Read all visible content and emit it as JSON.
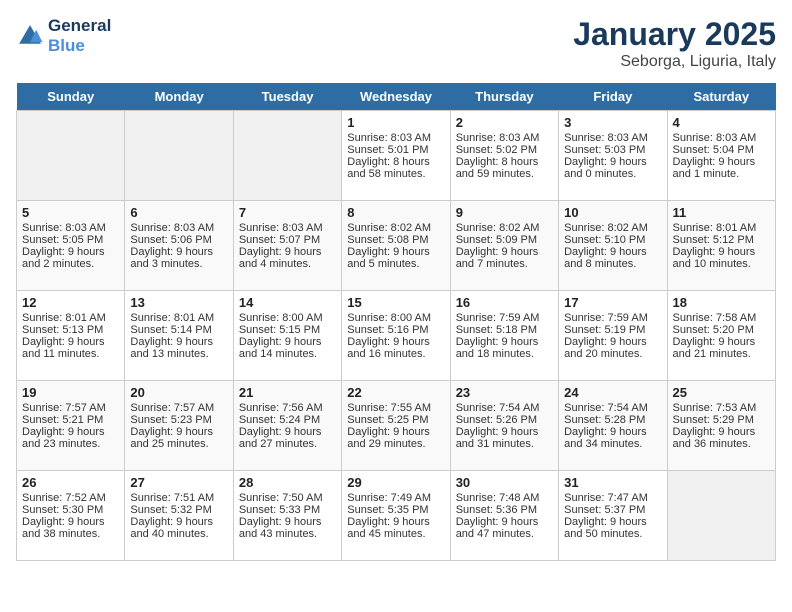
{
  "header": {
    "logo_line1": "General",
    "logo_line2": "Blue",
    "title": "January 2025",
    "subtitle": "Seborga, Liguria, Italy"
  },
  "days_of_week": [
    "Sunday",
    "Monday",
    "Tuesday",
    "Wednesday",
    "Thursday",
    "Friday",
    "Saturday"
  ],
  "weeks": [
    [
      {
        "date": "",
        "data": ""
      },
      {
        "date": "",
        "data": ""
      },
      {
        "date": "",
        "data": ""
      },
      {
        "date": "1",
        "sunrise": "Sunrise: 8:03 AM",
        "sunset": "Sunset: 5:01 PM",
        "daylight": "Daylight: 8 hours and 58 minutes."
      },
      {
        "date": "2",
        "sunrise": "Sunrise: 8:03 AM",
        "sunset": "Sunset: 5:02 PM",
        "daylight": "Daylight: 8 hours and 59 minutes."
      },
      {
        "date": "3",
        "sunrise": "Sunrise: 8:03 AM",
        "sunset": "Sunset: 5:03 PM",
        "daylight": "Daylight: 9 hours and 0 minutes."
      },
      {
        "date": "4",
        "sunrise": "Sunrise: 8:03 AM",
        "sunset": "Sunset: 5:04 PM",
        "daylight": "Daylight: 9 hours and 1 minute."
      }
    ],
    [
      {
        "date": "5",
        "sunrise": "Sunrise: 8:03 AM",
        "sunset": "Sunset: 5:05 PM",
        "daylight": "Daylight: 9 hours and 2 minutes."
      },
      {
        "date": "6",
        "sunrise": "Sunrise: 8:03 AM",
        "sunset": "Sunset: 5:06 PM",
        "daylight": "Daylight: 9 hours and 3 minutes."
      },
      {
        "date": "7",
        "sunrise": "Sunrise: 8:03 AM",
        "sunset": "Sunset: 5:07 PM",
        "daylight": "Daylight: 9 hours and 4 minutes."
      },
      {
        "date": "8",
        "sunrise": "Sunrise: 8:02 AM",
        "sunset": "Sunset: 5:08 PM",
        "daylight": "Daylight: 9 hours and 5 minutes."
      },
      {
        "date": "9",
        "sunrise": "Sunrise: 8:02 AM",
        "sunset": "Sunset: 5:09 PM",
        "daylight": "Daylight: 9 hours and 7 minutes."
      },
      {
        "date": "10",
        "sunrise": "Sunrise: 8:02 AM",
        "sunset": "Sunset: 5:10 PM",
        "daylight": "Daylight: 9 hours and 8 minutes."
      },
      {
        "date": "11",
        "sunrise": "Sunrise: 8:01 AM",
        "sunset": "Sunset: 5:12 PM",
        "daylight": "Daylight: 9 hours and 10 minutes."
      }
    ],
    [
      {
        "date": "12",
        "sunrise": "Sunrise: 8:01 AM",
        "sunset": "Sunset: 5:13 PM",
        "daylight": "Daylight: 9 hours and 11 minutes."
      },
      {
        "date": "13",
        "sunrise": "Sunrise: 8:01 AM",
        "sunset": "Sunset: 5:14 PM",
        "daylight": "Daylight: 9 hours and 13 minutes."
      },
      {
        "date": "14",
        "sunrise": "Sunrise: 8:00 AM",
        "sunset": "Sunset: 5:15 PM",
        "daylight": "Daylight: 9 hours and 14 minutes."
      },
      {
        "date": "15",
        "sunrise": "Sunrise: 8:00 AM",
        "sunset": "Sunset: 5:16 PM",
        "daylight": "Daylight: 9 hours and 16 minutes."
      },
      {
        "date": "16",
        "sunrise": "Sunrise: 7:59 AM",
        "sunset": "Sunset: 5:18 PM",
        "daylight": "Daylight: 9 hours and 18 minutes."
      },
      {
        "date": "17",
        "sunrise": "Sunrise: 7:59 AM",
        "sunset": "Sunset: 5:19 PM",
        "daylight": "Daylight: 9 hours and 20 minutes."
      },
      {
        "date": "18",
        "sunrise": "Sunrise: 7:58 AM",
        "sunset": "Sunset: 5:20 PM",
        "daylight": "Daylight: 9 hours and 21 minutes."
      }
    ],
    [
      {
        "date": "19",
        "sunrise": "Sunrise: 7:57 AM",
        "sunset": "Sunset: 5:21 PM",
        "daylight": "Daylight: 9 hours and 23 minutes."
      },
      {
        "date": "20",
        "sunrise": "Sunrise: 7:57 AM",
        "sunset": "Sunset: 5:23 PM",
        "daylight": "Daylight: 9 hours and 25 minutes."
      },
      {
        "date": "21",
        "sunrise": "Sunrise: 7:56 AM",
        "sunset": "Sunset: 5:24 PM",
        "daylight": "Daylight: 9 hours and 27 minutes."
      },
      {
        "date": "22",
        "sunrise": "Sunrise: 7:55 AM",
        "sunset": "Sunset: 5:25 PM",
        "daylight": "Daylight: 9 hours and 29 minutes."
      },
      {
        "date": "23",
        "sunrise": "Sunrise: 7:54 AM",
        "sunset": "Sunset: 5:26 PM",
        "daylight": "Daylight: 9 hours and 31 minutes."
      },
      {
        "date": "24",
        "sunrise": "Sunrise: 7:54 AM",
        "sunset": "Sunset: 5:28 PM",
        "daylight": "Daylight: 9 hours and 34 minutes."
      },
      {
        "date": "25",
        "sunrise": "Sunrise: 7:53 AM",
        "sunset": "Sunset: 5:29 PM",
        "daylight": "Daylight: 9 hours and 36 minutes."
      }
    ],
    [
      {
        "date": "26",
        "sunrise": "Sunrise: 7:52 AM",
        "sunset": "Sunset: 5:30 PM",
        "daylight": "Daylight: 9 hours and 38 minutes."
      },
      {
        "date": "27",
        "sunrise": "Sunrise: 7:51 AM",
        "sunset": "Sunset: 5:32 PM",
        "daylight": "Daylight: 9 hours and 40 minutes."
      },
      {
        "date": "28",
        "sunrise": "Sunrise: 7:50 AM",
        "sunset": "Sunset: 5:33 PM",
        "daylight": "Daylight: 9 hours and 43 minutes."
      },
      {
        "date": "29",
        "sunrise": "Sunrise: 7:49 AM",
        "sunset": "Sunset: 5:35 PM",
        "daylight": "Daylight: 9 hours and 45 minutes."
      },
      {
        "date": "30",
        "sunrise": "Sunrise: 7:48 AM",
        "sunset": "Sunset: 5:36 PM",
        "daylight": "Daylight: 9 hours and 47 minutes."
      },
      {
        "date": "31",
        "sunrise": "Sunrise: 7:47 AM",
        "sunset": "Sunset: 5:37 PM",
        "daylight": "Daylight: 9 hours and 50 minutes."
      },
      {
        "date": "",
        "data": ""
      }
    ]
  ]
}
